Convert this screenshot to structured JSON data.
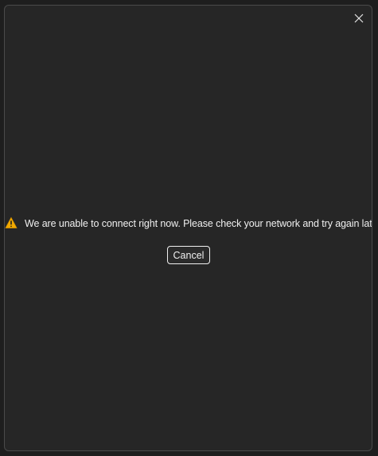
{
  "dialog": {
    "message": "We are unable to connect right now. Please check your network and try again later.",
    "cancel_label": "Cancel",
    "icons": {
      "close": "close-icon",
      "warning": "warning-icon"
    },
    "colors": {
      "background": "#262626",
      "text": "#f0f0f0",
      "warning_fill": "#f2a900"
    }
  }
}
